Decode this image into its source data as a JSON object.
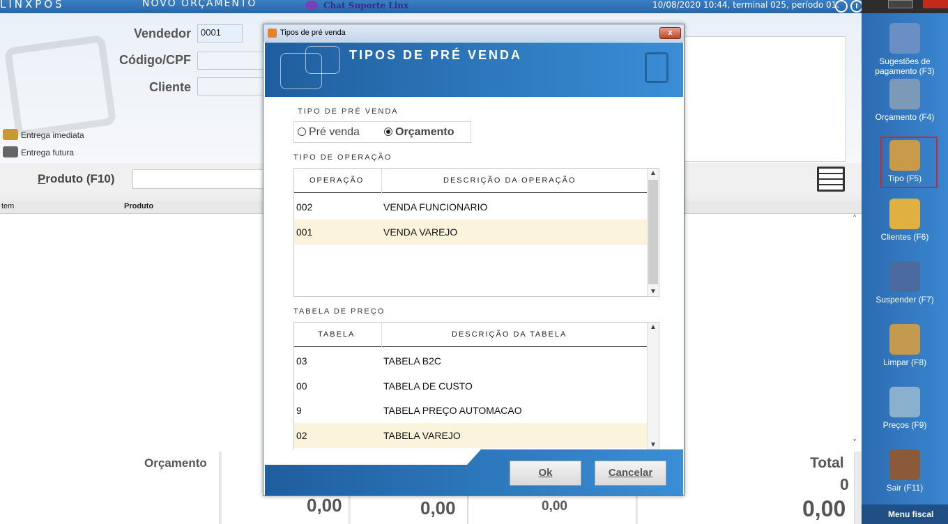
{
  "topbar": {
    "logo": "LINXPOS",
    "title": "Novo orçamento",
    "chat": "Chat Suporte Linx",
    "status": "10/08/2020 10:44, terminal 025, período 01.",
    "info_icon": "i"
  },
  "header": {
    "vendedor_label": "Vendedor",
    "vendedor_value": "0001",
    "codigo_label": "Código/CPF",
    "cliente_label": "Cliente",
    "entrega_imediata": "Entrega imediata",
    "entrega_futura": "Entrega futura"
  },
  "product": {
    "label_u": "P",
    "label_rest": "roduto (F10)"
  },
  "grid": {
    "col_item": "tem",
    "col_produto": "Produto",
    "scroll_up": "˄",
    "scroll_down": "˅"
  },
  "footer": {
    "orcamento_label": "Orçamento",
    "total_label": "Total",
    "value1": "0,00",
    "value2": "0,00",
    "value3": "0,00",
    "total_count": "0",
    "total_value": "0,00"
  },
  "sidebar": {
    "items": [
      {
        "label": "Sugestões de pagamento (F3)",
        "icon": "card-icon",
        "color": "#6a8fc4"
      },
      {
        "label": "Orçamento (F4)",
        "icon": "calculator-icon",
        "color": "#7a9ab8"
      },
      {
        "label": "Tipo (F5)",
        "icon": "shopping-bag-icon",
        "color": "#c89a4a"
      },
      {
        "label": "Clientes (F6)",
        "icon": "folder-people-icon",
        "color": "#e0b040"
      },
      {
        "label": "Suspender (F7)",
        "icon": "disc-box-icon",
        "color": "#4a6aa0"
      },
      {
        "label": "Limpar (F8)",
        "icon": "broom-icon",
        "color": "#c49a50"
      },
      {
        "label": "Preços (F9)",
        "icon": "magnifier-icon",
        "color": "#8ab0d0"
      },
      {
        "label": "Sair (F11)",
        "icon": "exit-door-icon",
        "color": "#8a5a3a"
      }
    ],
    "menu_fiscal": "Menu fiscal"
  },
  "modal": {
    "window_title": "Tipos de pré venda",
    "close_label": "x",
    "heading": "Tipos de pré venda",
    "section_tipo": "Tipo de pré venda",
    "radio_pre": "Pré venda",
    "radio_orc": "Orçamento",
    "selected_radio": "Orçamento",
    "section_operacao": "Tipo de operação",
    "op_headers": [
      "Operação",
      "Descrição da operação"
    ],
    "operations": [
      {
        "code": "002",
        "desc": "VENDA FUNCIONARIO",
        "selected": false
      },
      {
        "code": "001",
        "desc": "VENDA VAREJO",
        "selected": true
      }
    ],
    "section_tabela": "Tabela de preço",
    "tab_headers": [
      "Tabela",
      "Descrição da tabela"
    ],
    "tables": [
      {
        "code": "03",
        "desc": "TABELA B2C",
        "selected": false
      },
      {
        "code": "00",
        "desc": "TABELA DE CUSTO",
        "selected": false
      },
      {
        "code": "9",
        "desc": "TABELA PREÇO AUTOMACAO",
        "selected": false
      },
      {
        "code": "02",
        "desc": "TABELA VAREJO",
        "selected": true
      }
    ],
    "ok_label": "Ok",
    "cancel_label": "Cancelar"
  }
}
